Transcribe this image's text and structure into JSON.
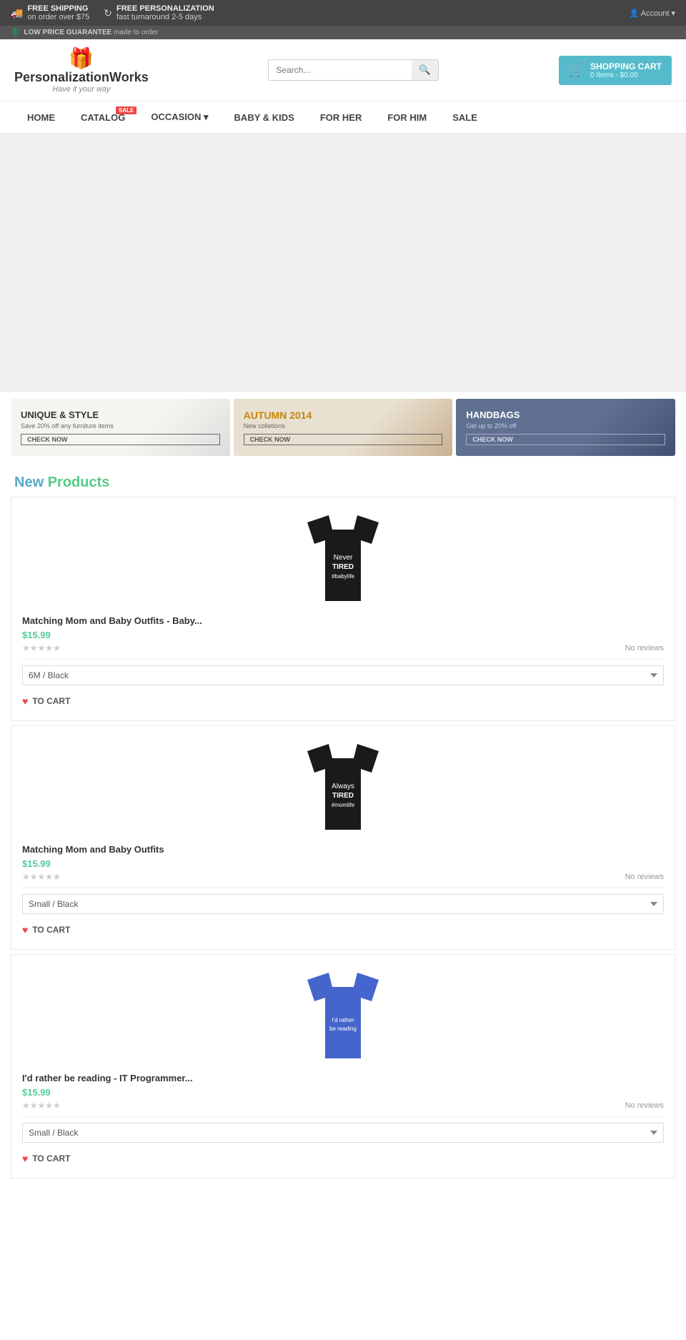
{
  "topbar": {
    "free_shipping_label": "FREE SHIPPING",
    "free_shipping_sub": "on order over $75",
    "refresh_label": "FREE PERSONALIZATION",
    "refresh_sub": "fast turnaround 2-5 days",
    "account_label": "Account"
  },
  "lowprice": {
    "label": "LOW PRICE GUARANTEE",
    "sub": "made to order"
  },
  "header": {
    "logo_title": "PersonalizationWorks",
    "logo_sub": "Have it your way",
    "search_placeholder": "Search...",
    "cart_label": "SHOPPING CART",
    "cart_items": "0 Items - $0.00"
  },
  "nav": {
    "items": [
      {
        "label": "HOME",
        "id": "home",
        "sale_badge": false
      },
      {
        "label": "CATALOG",
        "id": "catalog",
        "sale_badge": true
      },
      {
        "label": "OCCASION",
        "id": "occasion",
        "sale_badge": false,
        "has_dropdown": true
      },
      {
        "label": "BABY & KIDS",
        "id": "baby-kids",
        "sale_badge": false
      },
      {
        "label": "FOR HER",
        "id": "for-her",
        "sale_badge": false
      },
      {
        "label": "FOR HIM",
        "id": "for-him",
        "sale_badge": false
      },
      {
        "label": "SALE",
        "id": "sale",
        "sale_badge": false
      }
    ]
  },
  "promos": [
    {
      "style": "style1",
      "title": "UNIQUE & STYLE",
      "sub": "Save 20% off any furniture items",
      "btn": "CHECK NOW"
    },
    {
      "style": "style2",
      "title": "AUTUMN 2014",
      "sub": "New colletions",
      "btn": "CHECK NOW"
    },
    {
      "style": "style3",
      "title": "HANDBAGS",
      "sub": "Get up to 20% off",
      "btn": "CHECK NOW"
    }
  ],
  "section": {
    "new_label": "New",
    "products_label": "Products"
  },
  "products": [
    {
      "id": "product-1",
      "title": "Matching Mom and Baby Outfits - Baby...",
      "price": "$15.99",
      "reviews": "No reviews",
      "variant": "6M / Black",
      "cart_label": "TO CART",
      "tshirt_color": "#1a1a1a",
      "tshirt_text_line1": "Never",
      "tshirt_text_line2": "TIRED",
      "tshirt_text_line3": "#babylife"
    },
    {
      "id": "product-2",
      "title": "Matching Mom and Baby Outfits",
      "price": "$15.99",
      "reviews": "No reviews",
      "variant": "Small / Black",
      "cart_label": "TO CART",
      "tshirt_color": "#1a1a1a",
      "tshirt_text_line1": "Always",
      "tshirt_text_line2": "TIRED",
      "tshirt_text_line3": "#momlife"
    },
    {
      "id": "product-3",
      "title": "I'd rather be reading - IT Programmer...",
      "price": "$15.99",
      "reviews": "No reviews",
      "variant": "Small / Black",
      "cart_label": "TO CART",
      "tshirt_color": "#4466cc",
      "tshirt_text_line1": "I'd rather",
      "tshirt_text_line2": "be reading",
      "tshirt_text_line3": ""
    }
  ]
}
